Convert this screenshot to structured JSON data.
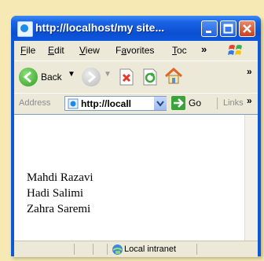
{
  "window": {
    "title": "http://localhost/my site..."
  },
  "menubar": {
    "items": [
      "File",
      "Edit",
      "View",
      "Favorites",
      "Toc"
    ],
    "overflow": "»"
  },
  "toolbar": {
    "back_label": "Back",
    "overflow": "»"
  },
  "address_bar": {
    "label": "Address",
    "url": "http://locall",
    "go_label": "Go",
    "links_label": "Links",
    "overflow": "»"
  },
  "content": {
    "lines": [
      "Mahdi Razavi",
      "Hadi Salimi",
      "Zahra Saremi"
    ]
  },
  "status_bar": {
    "zone": "Local intranet"
  }
}
